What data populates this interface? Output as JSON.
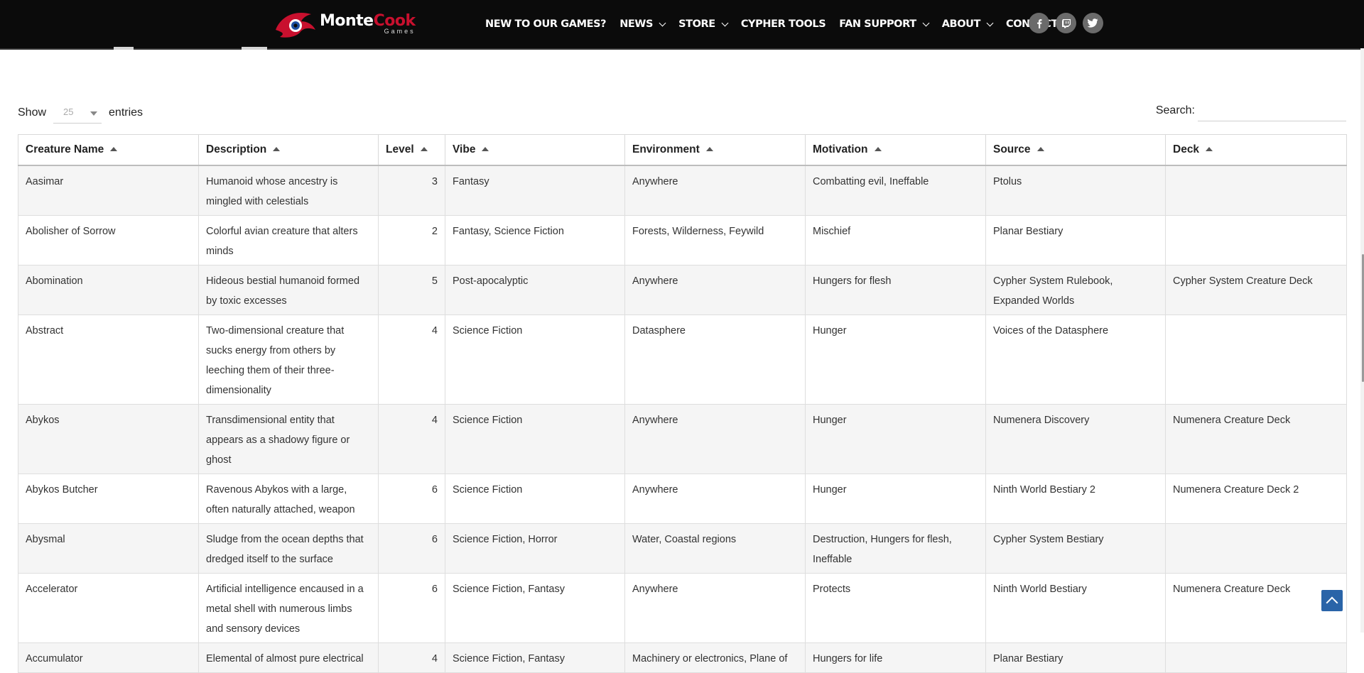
{
  "header": {
    "logo": {
      "text_main": "Monte",
      "text_accent": "Cook",
      "text_sub": "Games"
    },
    "nav": [
      {
        "label": "NEW TO OUR GAMES?",
        "dropdown": false
      },
      {
        "label": "NEWS",
        "dropdown": true
      },
      {
        "label": "STORE",
        "dropdown": true
      },
      {
        "label": "CYPHER TOOLS",
        "dropdown": false
      },
      {
        "label": "FAN SUPPORT",
        "dropdown": true
      },
      {
        "label": "ABOUT",
        "dropdown": true
      },
      {
        "label": "CONTACT US",
        "dropdown": false
      }
    ],
    "socials": [
      {
        "name": "facebook-icon",
        "glyph": "f"
      },
      {
        "name": "twitch-icon",
        "glyph": "t"
      },
      {
        "name": "twitter-icon",
        "glyph": "🐦"
      }
    ]
  },
  "controls": {
    "show_label": "Show",
    "entries_label": "entries",
    "page_length": "25",
    "search_label": "Search:",
    "search_value": ""
  },
  "table": {
    "columns": [
      "Creature Name",
      "Description",
      "Level",
      "Vibe",
      "Environment",
      "Motivation",
      "Source",
      "Deck"
    ],
    "rows": [
      [
        "Aasimar",
        "Humanoid whose ancestry is mingled with celestials",
        "3",
        "Fantasy",
        "Anywhere",
        "Combatting evil, Ineffable",
        "Ptolus",
        ""
      ],
      [
        "Abolisher of Sorrow",
        "Colorful avian creature that alters minds",
        "2",
        "Fantasy, Science Fiction",
        "Forests, Wilderness, Feywild",
        "Mischief",
        "Planar Bestiary",
        ""
      ],
      [
        "Abomination",
        "Hideous bestial humanoid formed by toxic excesses",
        "5",
        "Post-apocalyptic",
        "Anywhere",
        "Hungers for flesh",
        "Cypher System Rulebook, Expanded Worlds",
        "Cypher System Creature Deck"
      ],
      [
        "Abstract",
        "Two-dimensional creature that sucks energy from others by leeching them of their three-dimensionality",
        "4",
        "Science Fiction",
        "Datasphere",
        "Hunger",
        "Voices of the Datasphere",
        ""
      ],
      [
        "Abykos",
        "Transdimensional entity that appears as a shadowy figure or ghost",
        "4",
        "Science Fiction",
        "Anywhere",
        "Hunger",
        "Numenera Discovery",
        "Numenera Creature Deck"
      ],
      [
        "Abykos Butcher",
        "Ravenous Abykos with a large, often naturally attached, weapon",
        "6",
        "Science Fiction",
        "Anywhere",
        "Hunger",
        "Ninth World Bestiary 2",
        "Numenera Creature Deck 2"
      ],
      [
        "Abysmal",
        "Sludge from the ocean depths that dredged itself to the surface",
        "6",
        "Science Fiction, Horror",
        "Water, Coastal regions",
        "Destruction, Hungers for flesh, Ineffable",
        "Cypher System Bestiary",
        ""
      ],
      [
        "Accelerator",
        "Artificial intelligence encaused in a metal shell with numerous limbs and sensory devices",
        "6",
        "Science Fiction, Fantasy",
        "Anywhere",
        "Protects",
        "Ninth World Bestiary",
        "Numenera Creature Deck"
      ],
      [
        "Accumulator",
        "Elemental of almost pure electrical",
        "4",
        "Science Fiction, Fantasy",
        "Machinery or electronics, Plane of",
        "Hungers for life",
        "Planar Bestiary",
        ""
      ]
    ]
  },
  "colors": {
    "header_bg": "#0b0b0b",
    "brand_red": "#c8102e",
    "stripe": "#f5f5f5",
    "to_top": "#2a64a8"
  }
}
